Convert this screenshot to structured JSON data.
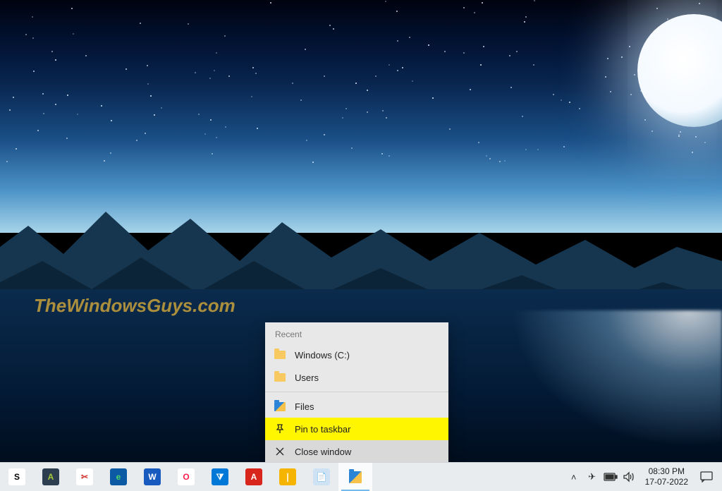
{
  "watermark": "TheWindowsGuys.com",
  "jumplist": {
    "section_recent": "Recent",
    "recent": [
      {
        "label": "Windows (C:)"
      },
      {
        "label": "Users"
      }
    ],
    "app_entry": "Files",
    "pin": "Pin to taskbar",
    "close": "Close window"
  },
  "taskbar_icons": [
    {
      "name": "svp",
      "bg": "#ffffff",
      "fg": "#000000",
      "glyph": "S"
    },
    {
      "name": "android-studio",
      "bg": "#2c3e50",
      "fg": "#a4c639",
      "glyph": "A"
    },
    {
      "name": "snipping",
      "bg": "#ffffff",
      "fg": "#d0342c",
      "glyph": "✂"
    },
    {
      "name": "edge",
      "bg": "#0c59a4",
      "fg": "#49d668",
      "glyph": "e"
    },
    {
      "name": "word",
      "bg": "#185abd",
      "fg": "#ffffff",
      "glyph": "W"
    },
    {
      "name": "opera",
      "bg": "#ffffff",
      "fg": "#fa1e4e",
      "glyph": "O"
    },
    {
      "name": "vscode",
      "bg": "#0078d7",
      "fg": "#ffffff",
      "glyph": "⧩"
    },
    {
      "name": "acrobat",
      "bg": "#d9261c",
      "fg": "#ffffff",
      "glyph": "A"
    },
    {
      "name": "doc",
      "bg": "#f4b400",
      "fg": "#ffffff",
      "glyph": "❘"
    },
    {
      "name": "notepad",
      "bg": "#cfe2f3",
      "fg": "#2a66b1",
      "glyph": "📄"
    },
    {
      "name": "file-explorer",
      "bg": "#f7c24b",
      "fg": "#2c84d6",
      "glyph": ""
    }
  ],
  "tray": {
    "chevron": "˄",
    "airplane": "✈",
    "battery": "▭",
    "volume": "🔊",
    "time": "08:30 PM",
    "date": "17-07-2022",
    "action": "💬"
  }
}
